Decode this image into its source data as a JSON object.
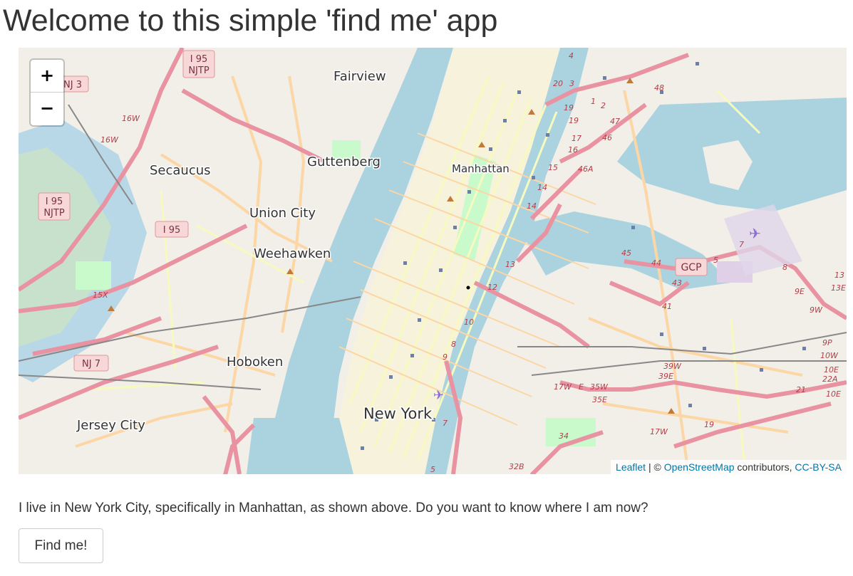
{
  "page": {
    "title": "Welcome to this simple 'find me' app",
    "description": "I live in New York City, specifically in Manhattan, as shown above. Do you want to know where I am now?",
    "find_button_label": "Find me!"
  },
  "map": {
    "zoom_in_label": "+",
    "zoom_out_label": "−",
    "attribution": {
      "leaflet": "Leaflet",
      "separator": " | © ",
      "osm": "OpenStreetMap",
      "contributors": " contributors, ",
      "license": "CC-BY-SA"
    },
    "places": {
      "fairview": "Fairview",
      "guttenberg": "Guttenberg",
      "secaucus": "Secaucus",
      "union_city": "Union City",
      "weehawken": "Weehawken",
      "hoboken": "Hoboken",
      "jersey_city": "Jersey City",
      "new_york": "New York",
      "manhattan": "Manhattan"
    },
    "shields": {
      "i95_njtp_top_line1": "I 95",
      "i95_njtp_top_line2": "NJTP",
      "nj3": "NJ 3",
      "i95_njtp_left_line1": "I 95",
      "i95_njtp_left_line2": "NJTP",
      "i95": "I 95",
      "nj7": "NJ 7",
      "gcp": "GCP"
    },
    "exits": [
      "4",
      "20",
      "3",
      "1",
      "2",
      "48",
      "19",
      "19",
      "47",
      "46",
      "17",
      "16",
      "15",
      "46A",
      "14",
      "14",
      "13",
      "12",
      "10",
      "9",
      "8",
      "7",
      "5",
      "16W",
      "16W",
      "15X",
      "45",
      "44",
      "43",
      "41",
      "7",
      "8",
      "9E",
      "9W",
      "9P",
      "10W",
      "10E",
      "22A",
      "21",
      "10E",
      "39W",
      "39E",
      "17W",
      "E",
      "35W",
      "35E",
      "34",
      "32B",
      "19",
      "17W",
      "13",
      "13E",
      "5"
    ]
  },
  "colors": {
    "water": "#aad3df",
    "land": "#f2efe9",
    "park": "#c8facc",
    "major_road": "#e892a2",
    "secondary_road": "#fcd6a4",
    "minor_road": "#f7fabf",
    "link": "#0078a8"
  }
}
